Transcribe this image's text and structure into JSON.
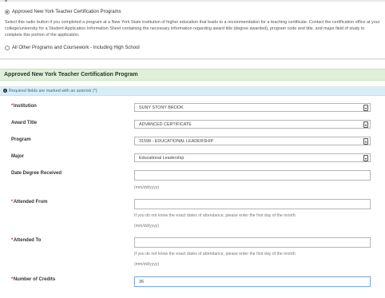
{
  "program_choice": {
    "option_approved": {
      "label": "Approved New York Teacher Certification Programs",
      "selected": true
    },
    "description": "Select this radio button if you completed a program at a New York State institution of higher education that leads to a recommendation for a teaching certificate. Contact the certification office at your college/university for a Student Application Information Sheet containing the necessary information regarding award title (degree awarded), program code and title, and major field of study to complete this portion of the application.",
    "option_other": {
      "label": "All Other Programs and Coursework - Including High School",
      "selected": false
    }
  },
  "section": {
    "title": "Approved New York Teacher Certification Program",
    "info_icon": "info-circle-icon",
    "required_notice": "Required fields are marked with an asterisk (*)"
  },
  "form": {
    "required_marker": "*",
    "institution": {
      "label": "Institution",
      "value": "SUNY STONY BROOK"
    },
    "award_title": {
      "label": "Award Title",
      "value": "ADVANCED CERTIFICATE"
    },
    "program": {
      "label": "Program",
      "value": "31598 - EDUCATIONAL LEADERSHIP"
    },
    "major": {
      "label": "Major",
      "value": "Educational Leadership"
    },
    "date_degree_received": {
      "label": "Date Degree Received",
      "value": "",
      "format_hint": "(mm/dd/yyyy)"
    },
    "attended_from": {
      "label": "Attended From",
      "value": "",
      "help": "If you do not know the exact dates of attendance, please enter the first day of the month.",
      "format_hint": "(mm/dd/yyyy)"
    },
    "attended_to": {
      "label": "Attended To",
      "value": "",
      "help": "If you do not know the exact dates of attendance, please enter the first day of the month.",
      "format_hint": "(mm/dd/yyyy)"
    },
    "number_of_credits": {
      "label": "Number of Credits",
      "value": "36"
    }
  },
  "colors": {
    "section_header_bg": "#dff0d8",
    "info_bar_bg": "#d9edf7",
    "required_asterisk": "#c9302c",
    "focus_border": "#7fb0e0"
  }
}
